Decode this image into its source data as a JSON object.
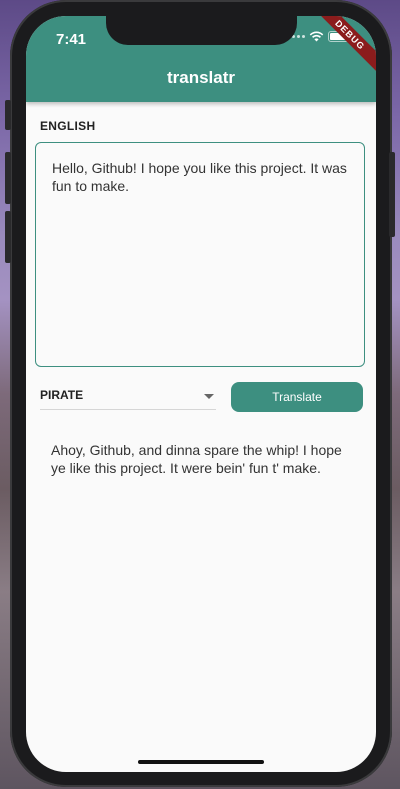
{
  "status_bar": {
    "time": "7:41"
  },
  "app_bar": {
    "title": "translatr"
  },
  "debug_banner": "DEBUG",
  "source": {
    "language_label": "ENGLISH",
    "text": "Hello, Github! I hope you like this project. It was fun to make."
  },
  "target": {
    "selected_language": "PIRATE",
    "translate_button_label": "Translate",
    "output_text": "Ahoy, Github, and dinna spare the whip! I hope ye like this project.  It were bein' fun t' make."
  },
  "colors": {
    "accent": "#3d8f80",
    "debug_banner": "#8b1c1c"
  },
  "icons": {
    "wifi": "wifi-icon",
    "battery": "battery-icon",
    "signal": "signal-dots-icon",
    "dropdown": "chevron-down-icon"
  }
}
